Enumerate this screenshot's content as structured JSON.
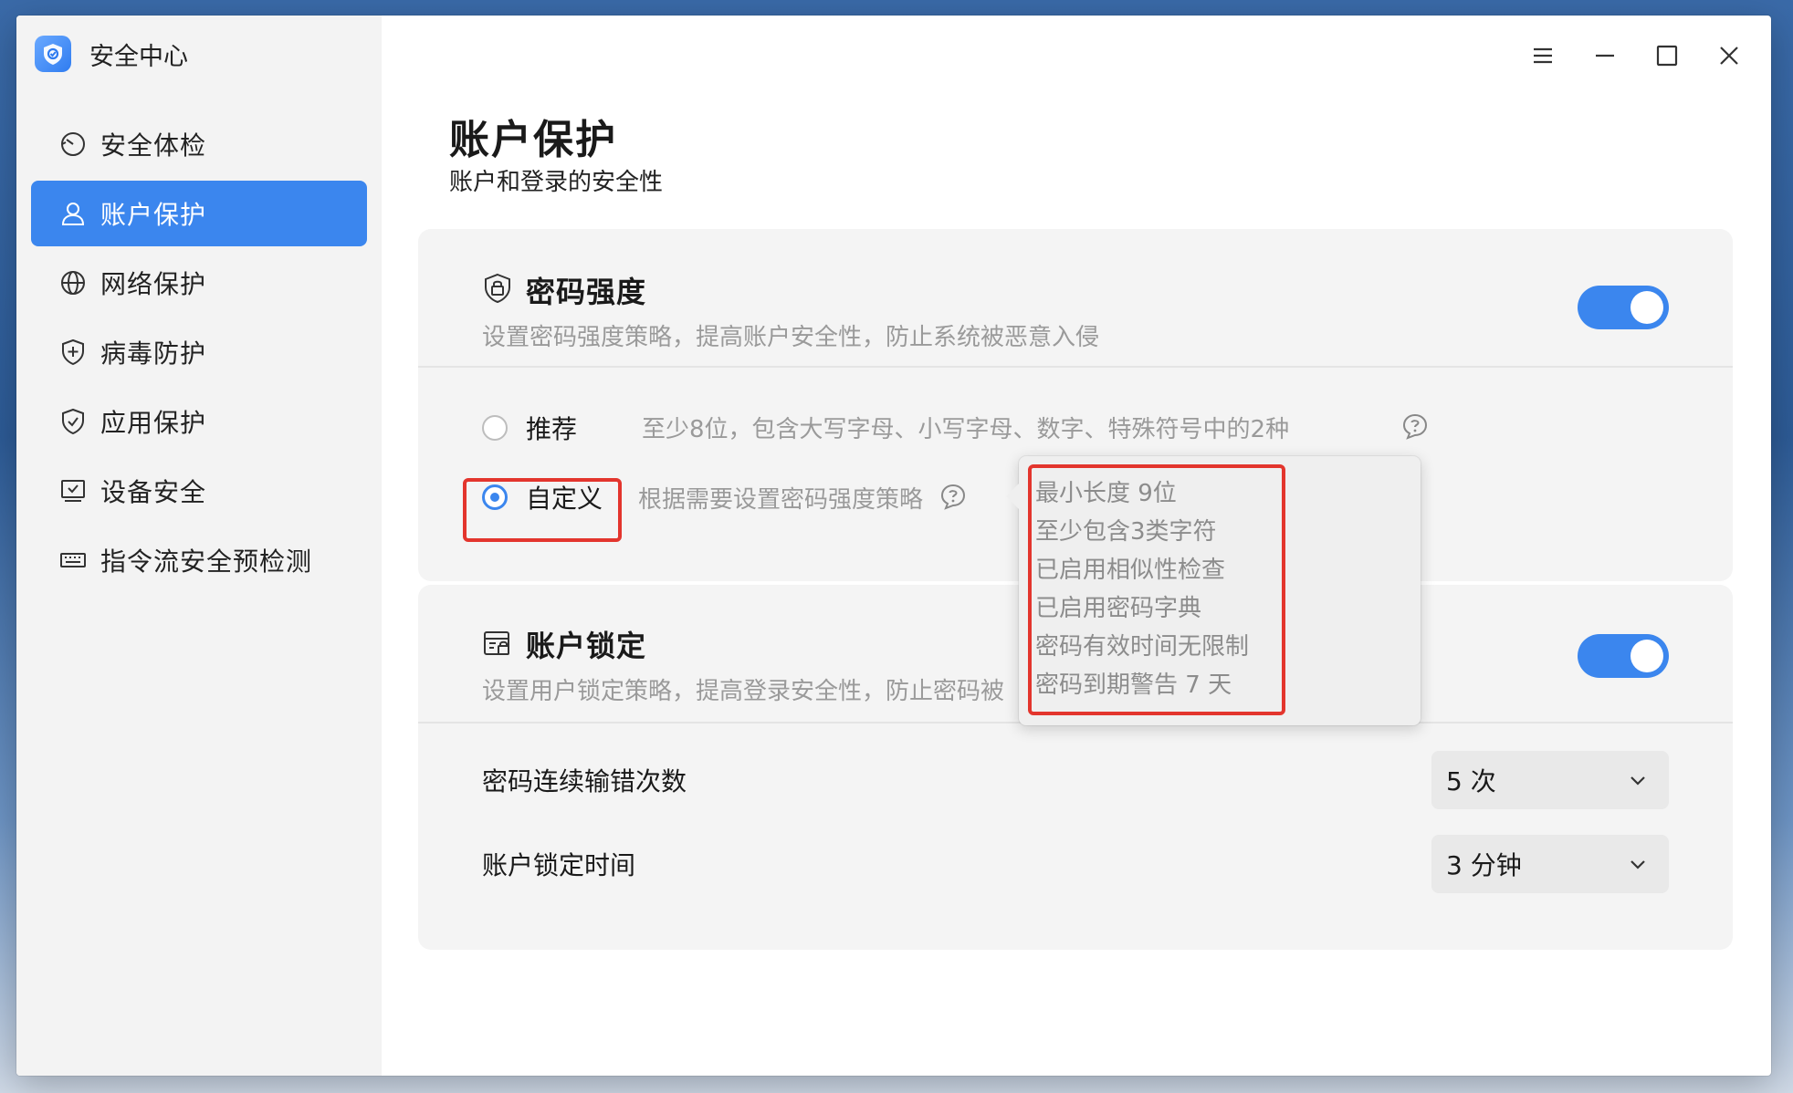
{
  "app": {
    "title": "安全中心"
  },
  "sidebar": {
    "items": [
      {
        "label": "安全体检",
        "icon": "scan-clock-icon",
        "active": false
      },
      {
        "label": "账户保护",
        "icon": "user-icon",
        "active": true
      },
      {
        "label": "网络保护",
        "icon": "globe-icon",
        "active": false
      },
      {
        "label": "病毒防护",
        "icon": "shield-plus-icon",
        "active": false
      },
      {
        "label": "应用保护",
        "icon": "shield-check-icon",
        "active": false
      },
      {
        "label": "设备安全",
        "icon": "monitor-check-icon",
        "active": false
      },
      {
        "label": "指令流安全预检测",
        "icon": "keyboard-icon",
        "active": false
      }
    ]
  },
  "titlebar": {
    "buttons": [
      "menu-icon",
      "minimize-icon",
      "maximize-icon",
      "close-icon"
    ]
  },
  "page": {
    "title": "账户保护",
    "subtitle": "账户和登录的安全性"
  },
  "password_strength": {
    "title": "密码强度",
    "description": "设置密码强度策略，提高账户安全性，防止系统被恶意入侵",
    "enabled": true,
    "options": [
      {
        "label": "推荐",
        "description": "至少8位，包含大写字母、小写字母、数字、特殊符号中的2种",
        "selected": false
      },
      {
        "label": "自定义",
        "description": "根据需要设置密码强度策略",
        "selected": true
      }
    ],
    "tooltip": [
      "最小长度 9位",
      "至少包含3类字符",
      "已启用相似性检查",
      "已启用密码字典",
      "密码有效时间无限制",
      "密码到期警告 7 天"
    ]
  },
  "account_lock": {
    "title": "账户锁定",
    "description": "设置用户锁定策略，提高登录安全性，防止密码被",
    "enabled": true,
    "settings": [
      {
        "label": "密码连续输错次数",
        "value": "5 次"
      },
      {
        "label": "账户锁定时间",
        "value": "3 分钟"
      }
    ]
  },
  "colors": {
    "accent": "#3b86ee",
    "highlight": "#e3352d"
  }
}
